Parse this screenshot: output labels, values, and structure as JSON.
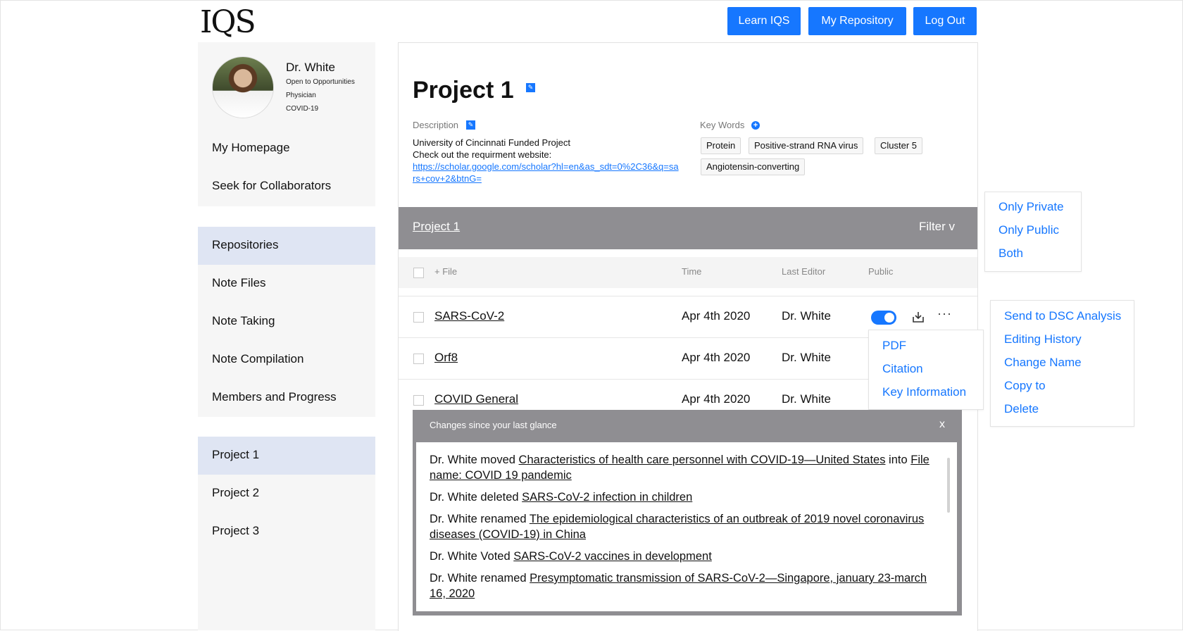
{
  "header": {
    "logo": "IQS",
    "buttons": [
      "Learn IQS",
      "My Repository",
      "Log Out"
    ]
  },
  "profile": {
    "name": "Dr. White",
    "status": "Open to Opportunities",
    "role": "Physician",
    "topic": "COVID-19",
    "links": [
      "My Homepage",
      "Seek for Collaborators"
    ]
  },
  "sidebar": {
    "sections": [
      "Repositories",
      "Note Files",
      "Note Taking",
      "Note Compilation",
      "Members and Progress"
    ],
    "projects": [
      "Project 1",
      "Project 2",
      "Project 3"
    ]
  },
  "project": {
    "title": "Project 1",
    "description_label": "Description",
    "description_lines": [
      "University of Cincinnati Funded Project",
      "Check out the requirment website:"
    ],
    "description_link": "https://scholar.google.com/scholar?hl=en&as_sdt=0%2C36&q=sars+cov+2&btnG=",
    "keywords_label": "Key Words",
    "keywords": [
      "Protein",
      "Positive-strand RNA virus",
      "Cluster 5",
      "Angiotensin-converting"
    ]
  },
  "files_bar": {
    "breadcrumb": "Project 1",
    "filter": "Filter v"
  },
  "table": {
    "headers": [
      "+ File",
      "Time",
      "Last Editor",
      "Public"
    ],
    "rows": [
      {
        "name": "SARS-CoV-2",
        "time": "Apr 4th 2020",
        "editor": "Dr. White"
      },
      {
        "name": "Orf8",
        "time": "Apr 4th 2020",
        "editor": "Dr. White"
      },
      {
        "name": "COVID General",
        "time": "Apr 4th 2020",
        "editor": "Dr. White"
      }
    ]
  },
  "visibility_menu": [
    "Only Private",
    "Only Public",
    "Both"
  ],
  "download_menu": [
    "PDF",
    "Citation",
    "Key Information"
  ],
  "more_menu": [
    "Send to DSC Analysis",
    "Editing History",
    "Change Name",
    "Copy to",
    "Delete"
  ],
  "changes": {
    "title": "Changes since your last glance",
    "close": "x",
    "items": [
      {
        "prefix": "Dr. White moved ",
        "link": "Characteristics of health care personnel with COVID-19—United States",
        "middle": " into ",
        "link2": "File name: COVID 19 pandemic"
      },
      {
        "prefix": "Dr. White deleted ",
        "link": "SARS-CoV-2 infection in children"
      },
      {
        "prefix": "Dr. White renamed ",
        "link": "The epidemiological characteristics of an outbreak of 2019 novel coronavirus diseases (COVID-19) in China"
      },
      {
        "prefix": "Dr. White Voted ",
        "link": "SARS-CoV-2 vaccines in development"
      },
      {
        "prefix": "Dr. White renamed ",
        "link": "Presymptomatic transmission of SARS-CoV-2—Singapore, january 23-march 16, 2020"
      }
    ]
  },
  "colors": {
    "accent": "#1677ff",
    "bar_grey": "#8f8e92",
    "sidebar_bg": "#f6f6f6",
    "active_bg": "#dfe5f3"
  }
}
